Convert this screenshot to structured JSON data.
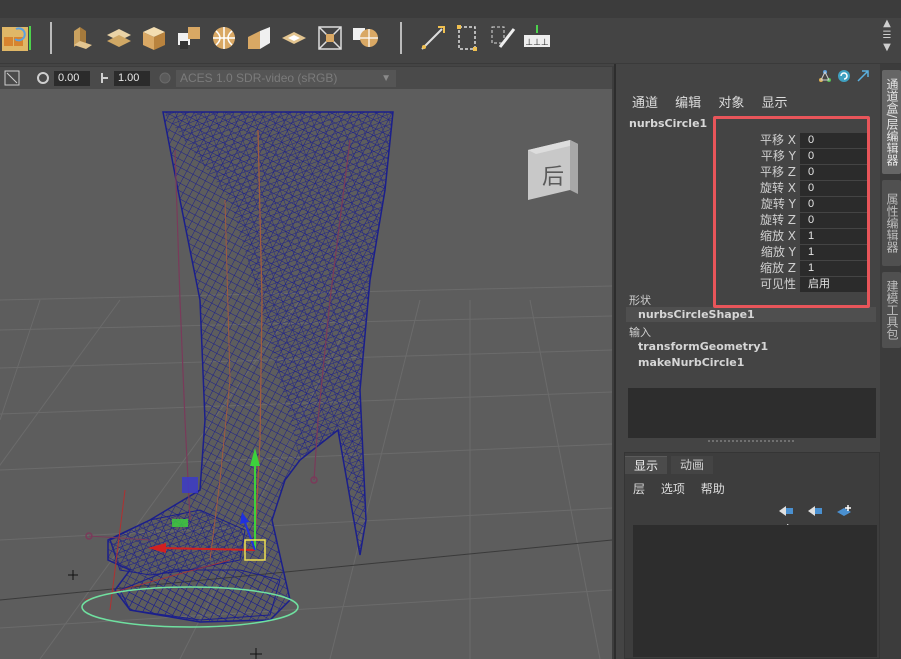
{
  "viewport": {
    "field1": "0.00",
    "field2": "1.00",
    "colorspace": "ACES 1.0 SDR-video (sRGB)",
    "viewcube_label": "后"
  },
  "channel_box": {
    "menu": [
      "通道",
      "编辑",
      "对象",
      "显示"
    ],
    "object_name": "nurbsCircle1",
    "attributes": [
      {
        "label": "平移 X",
        "value": "0"
      },
      {
        "label": "平移 Y",
        "value": "0"
      },
      {
        "label": "平移 Z",
        "value": "0"
      },
      {
        "label": "旋转 X",
        "value": "0"
      },
      {
        "label": "旋转 Y",
        "value": "0"
      },
      {
        "label": "旋转 Z",
        "value": "0"
      },
      {
        "label": "缩放 X",
        "value": "1"
      },
      {
        "label": "缩放 Y",
        "value": "1"
      },
      {
        "label": "缩放 Z",
        "value": "1"
      },
      {
        "label": "可见性",
        "value": "启用"
      }
    ],
    "shapes_title": "形状",
    "shape_name": "nurbsCircleShape1",
    "inputs_title": "输入",
    "inputs": [
      "transformGeometry1",
      "makeNurbCircle1"
    ]
  },
  "layer_editor": {
    "tabs": [
      "显示",
      "动画"
    ],
    "menu": [
      "层",
      "选项",
      "帮助"
    ]
  },
  "side_tabs": [
    "通道盒/层编辑器",
    "属性编辑器",
    "建模工具包"
  ],
  "colors": {
    "highlight": "#e8555a",
    "wireframe": "#1b1f8c",
    "selection_circle": "#6fe0a0"
  }
}
